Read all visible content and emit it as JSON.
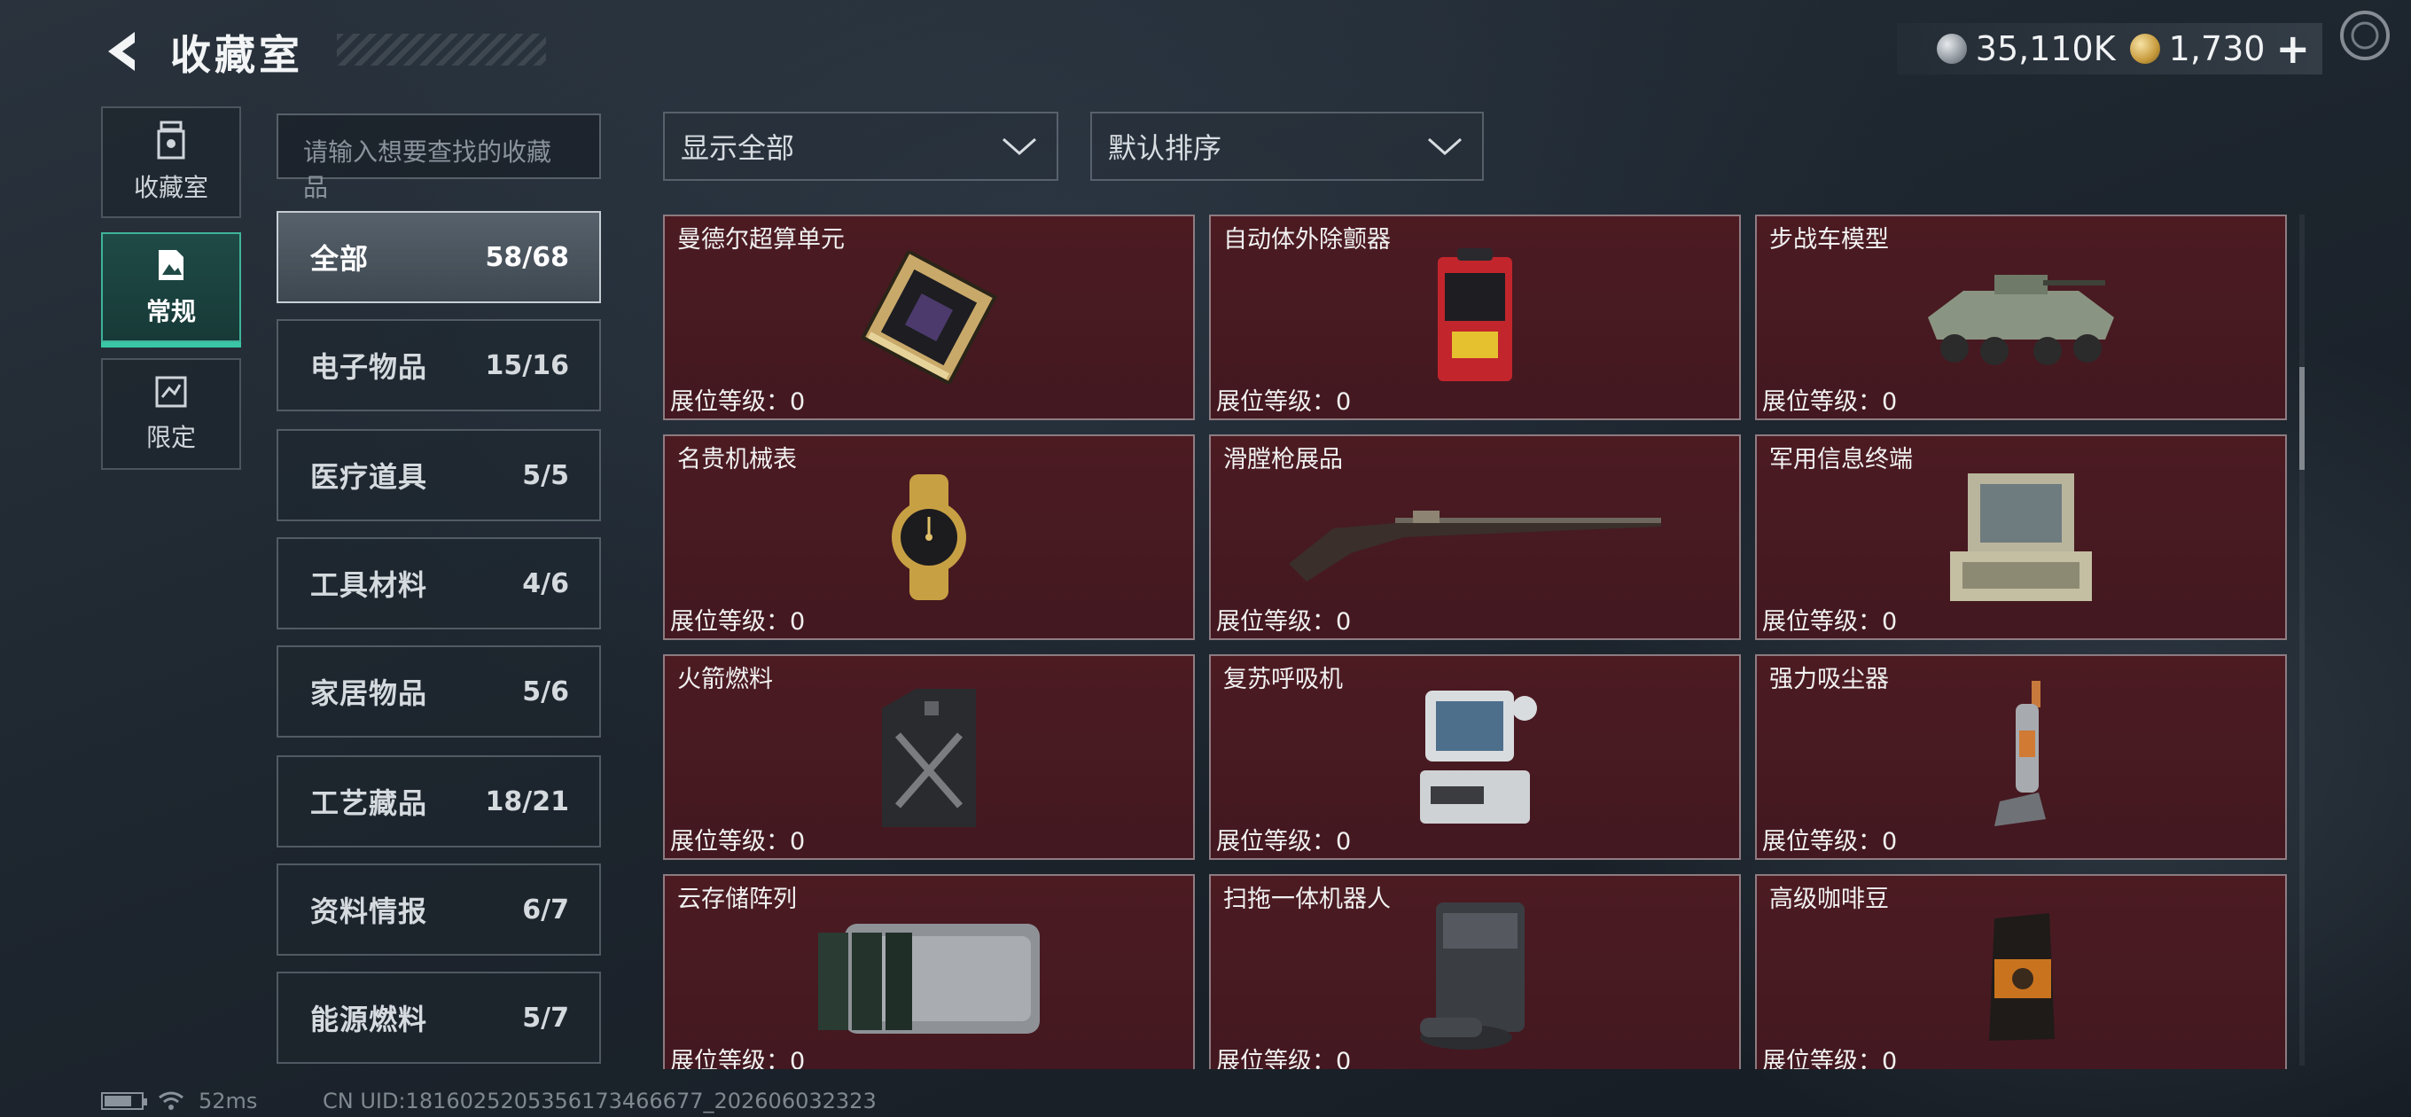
{
  "header": {
    "title": "收藏室",
    "currencies": [
      {
        "icon": "silver-coin-icon",
        "value": "35,110K"
      },
      {
        "icon": "gold-coin-icon",
        "value": "1,730"
      }
    ],
    "plus_label": "+"
  },
  "side_tabs": [
    {
      "label": "收藏室",
      "icon": "collection-room-icon",
      "active": false
    },
    {
      "label": "常规",
      "icon": "regular-icon",
      "active": true
    },
    {
      "label": "限定",
      "icon": "limited-icon",
      "active": false
    }
  ],
  "search": {
    "placeholder": "请输入想要查找的收藏品"
  },
  "categories": [
    {
      "name": "全部",
      "count": "58/68",
      "active": true
    },
    {
      "name": "电子物品",
      "count": "15/16"
    },
    {
      "name": "医疗道具",
      "count": "5/5"
    },
    {
      "name": "工具材料",
      "count": "4/6"
    },
    {
      "name": "家居物品",
      "count": "5/6"
    },
    {
      "name": "工艺藏品",
      "count": "18/21"
    },
    {
      "name": "资料情报",
      "count": "6/7"
    },
    {
      "name": "能源燃料",
      "count": "5/7"
    }
  ],
  "filters": {
    "display": "显示全部",
    "sort": "默认排序"
  },
  "level_label": "展位等级：",
  "items": [
    {
      "name": "曼德尔超算单元",
      "level": "0",
      "icon": "supercomputer-unit-icon"
    },
    {
      "name": "自动体外除颤器",
      "level": "0",
      "icon": "defibrillator-icon"
    },
    {
      "name": "步战车模型",
      "level": "0",
      "icon": "ifv-model-icon"
    },
    {
      "name": "名贵机械表",
      "level": "0",
      "icon": "luxury-watch-icon"
    },
    {
      "name": "滑膛枪展品",
      "level": "0",
      "icon": "musket-icon"
    },
    {
      "name": "军用信息终端",
      "level": "0",
      "icon": "military-terminal-icon"
    },
    {
      "name": "火箭燃料",
      "level": "0",
      "icon": "rocket-fuel-icon"
    },
    {
      "name": "复苏呼吸机",
      "level": "0",
      "icon": "ventilator-icon"
    },
    {
      "name": "强力吸尘器",
      "level": "0",
      "icon": "vacuum-cleaner-icon"
    },
    {
      "name": "云存储阵列",
      "level": "0",
      "icon": "cloud-storage-icon"
    },
    {
      "name": "扫拖一体机器人",
      "level": "0",
      "icon": "robot-mop-icon"
    },
    {
      "name": "高级咖啡豆",
      "level": "0",
      "icon": "coffee-beans-icon"
    }
  ],
  "status": {
    "ping": "52ms",
    "uid": "CN UID:1816025205356173466677_202606032323"
  },
  "colors": {
    "card_bg": "#4a1a21",
    "accent": "#39c6a6"
  }
}
